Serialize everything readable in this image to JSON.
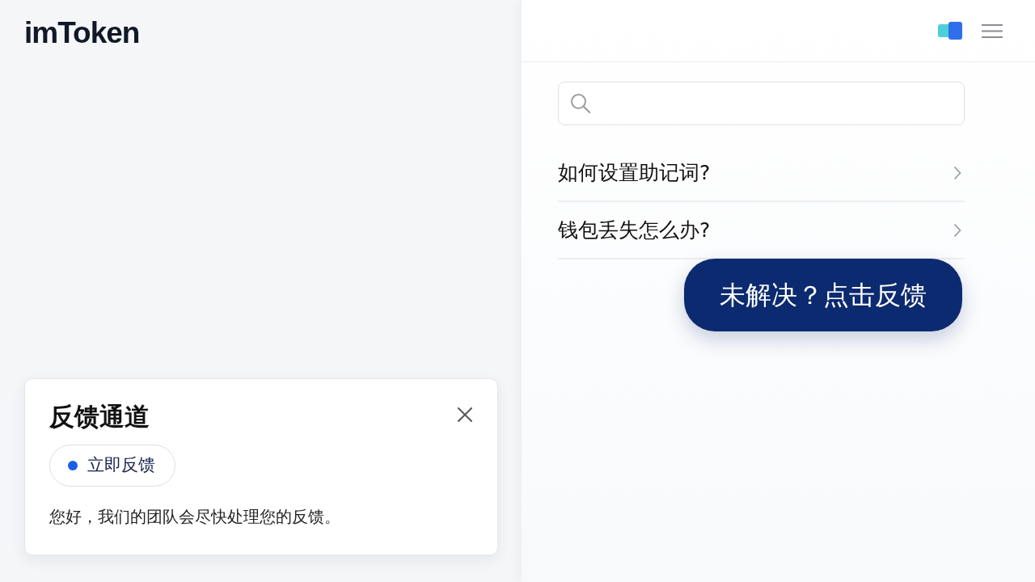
{
  "logo": {
    "text": "imToken"
  },
  "faq": [
    {
      "question": "如何设置助记词?"
    },
    {
      "question": "钱包丢失怎么办?"
    }
  ],
  "floating_button": {
    "label": "未解决？点击反馈"
  },
  "feedback_panel": {
    "title": "反馈通道",
    "button": {
      "label": "立即反馈"
    },
    "message": "您好，我们的团队会尽快处理您的反馈。"
  }
}
